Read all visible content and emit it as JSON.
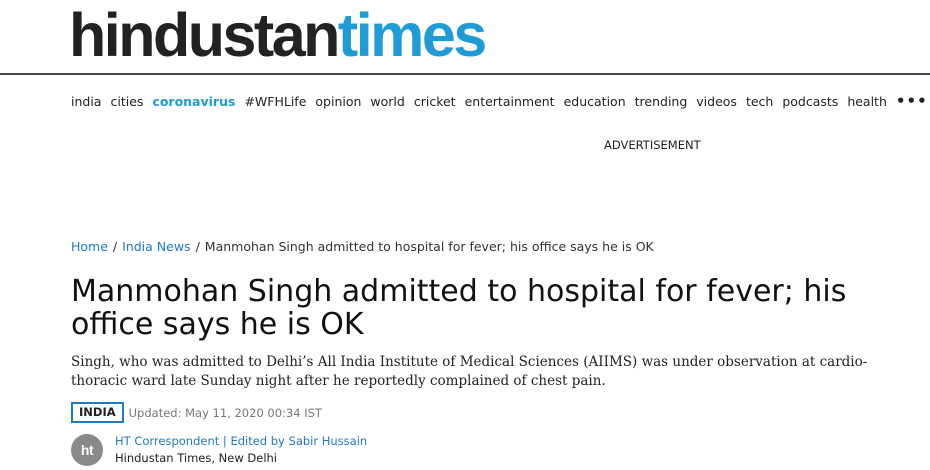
{
  "logo": {
    "part1": "hindustan",
    "part2": "times"
  },
  "nav": {
    "items": [
      {
        "label": "india"
      },
      {
        "label": "cities"
      },
      {
        "label": "coronavirus",
        "active": true
      },
      {
        "label": "#WFHLife"
      },
      {
        "label": "opinion"
      },
      {
        "label": "world"
      },
      {
        "label": "cricket"
      },
      {
        "label": "entertainment"
      },
      {
        "label": "education"
      },
      {
        "label": "trending"
      },
      {
        "label": "videos"
      },
      {
        "label": "tech"
      },
      {
        "label": "podcasts"
      },
      {
        "label": "health"
      }
    ],
    "more": "•••"
  },
  "advertisement": "ADVERTISEMENT",
  "breadcrumb": {
    "home": "Home",
    "section": "India News",
    "separator": "/",
    "current": "Manmohan Singh admitted to hospital for fever; his office says he is OK"
  },
  "article": {
    "headline": "Manmohan Singh admitted to hospital for fever; his office says he is OK",
    "summary": "Singh, who was admitted to Delhi’s All India Institute of Medical Sciences (AIIMS) was under observation at cardio-thoracic ward late Sunday night after he reportedly complained of chest pain.",
    "tag": "INDIA",
    "updated": "Updated: May 11, 2020 00:34 IST",
    "author": {
      "avatar_text": "ht",
      "correspondent": "HT Correspondent",
      "divider": "|",
      "edited_by": "Edited by Sabir Hussain",
      "place": "Hindustan Times, New Delhi"
    }
  },
  "colors": {
    "brand_blue": "#1f9bd6",
    "link_blue": "#1f79c4",
    "text_dark": "#222222"
  }
}
